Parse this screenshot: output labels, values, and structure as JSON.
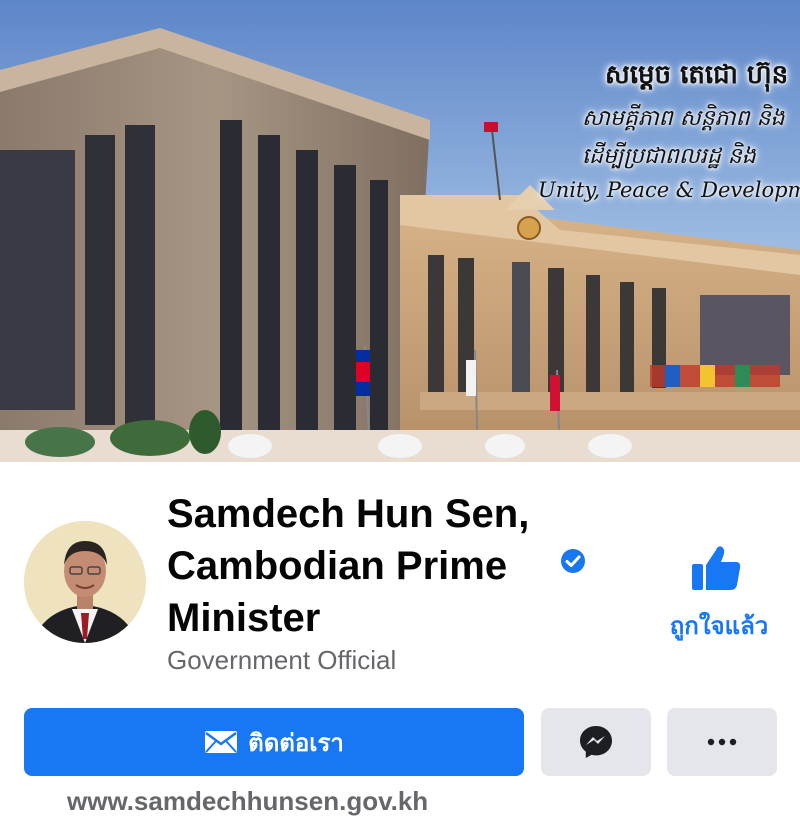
{
  "cover": {
    "title_khmer": "សម្ដេច តេជោ ហ៊ុន",
    "subtitle_line1": "សាមគ្គីភាព សន្តិភាព និង",
    "subtitle_line2": "ដើម្បីប្រជាពលរដ្ឋ និង",
    "slogan": "Unity, Peace & Development for a"
  },
  "profile": {
    "name": "Samdech Hun Sen, Cambodian Prime Minister",
    "category": "Government Official",
    "verified": true
  },
  "like": {
    "label": "ถูกใจแล้ว",
    "icon": "thumbs-up-icon"
  },
  "actions": {
    "contact_label": "ติดต่อเรา",
    "contact_icon": "envelope-icon",
    "messenger_icon": "messenger-icon",
    "more_icon": "more-dots-icon"
  },
  "website": "www.samdechhunsen.gov.kh",
  "colors": {
    "accent": "#1877f2",
    "secondary_button": "#e4e6eb",
    "muted_text": "#65676b",
    "name_text": "#050505"
  }
}
